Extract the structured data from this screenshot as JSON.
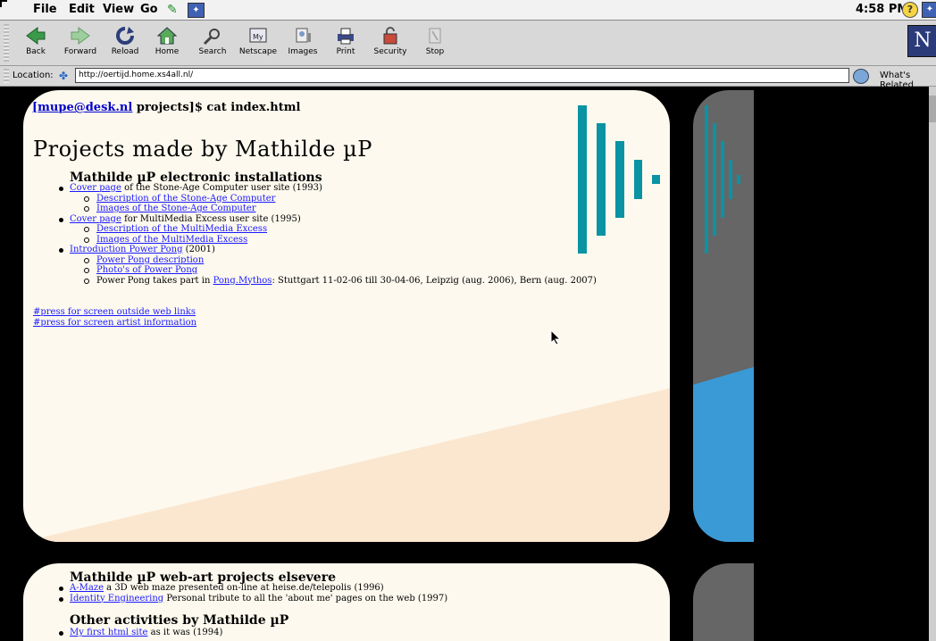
{
  "menubar": {
    "items": [
      "File",
      "Edit",
      "View",
      "Go"
    ],
    "clock": "4:58 PM",
    "help_glyph": "?",
    "app_glyph": "N"
  },
  "toolbar": {
    "buttons": [
      {
        "label": "Back",
        "icon": "back-arrow-icon"
      },
      {
        "label": "Forward",
        "icon": "forward-arrow-icon"
      },
      {
        "label": "Reload",
        "icon": "reload-icon"
      },
      {
        "label": "Home",
        "icon": "home-icon"
      },
      {
        "label": "Search",
        "icon": "search-icon"
      },
      {
        "label": "Netscape",
        "icon": "netscape-icon"
      },
      {
        "label": "Images",
        "icon": "images-icon"
      },
      {
        "label": "Print",
        "icon": "print-icon"
      },
      {
        "label": "Security",
        "icon": "security-lock-icon"
      },
      {
        "label": "Stop",
        "icon": "stop-icon"
      }
    ],
    "logo": "N"
  },
  "location": {
    "label": "Location:",
    "url": "http://oertijd.home.xs4all.nl/",
    "related": "What's Related"
  },
  "page": {
    "prompt_user": "[mupe@desk.nl",
    "prompt_rest": " projects]$ cat index.html",
    "title": "Projects made by Mathilde µP",
    "section1": {
      "heading": "Mathilde µP electronic installations",
      "items": [
        {
          "type": "main",
          "link": "Cover page",
          "text": " of the Stone-Age Computer user site (1993)"
        },
        {
          "type": "sub",
          "link": "Description of the Stone-Age Computer ",
          "text": ""
        },
        {
          "type": "sub",
          "link": "Images of the Stone-Age Computer ",
          "text": ""
        },
        {
          "type": "main",
          "link": "Cover page",
          "text": " for MultiMedia Excess user site (1995)"
        },
        {
          "type": "sub",
          "link": "Description of the MultiMedia Excess",
          "text": ""
        },
        {
          "type": "sub",
          "link": "Images of the MultiMedia Excess",
          "text": ""
        },
        {
          "type": "main",
          "link": "Introduction Power Pong",
          "text": " (2001)"
        },
        {
          "type": "sub",
          "link": "Power Pong description",
          "text": ""
        },
        {
          "type": "sub",
          "link": "Photo's of Power Pong",
          "text": ""
        },
        {
          "type": "sub",
          "pre": "Power Pong takes part in ",
          "link": "Pong.Mythos",
          "text": ": Stuttgart 11-02-06 till 30-04-06, Leipzig (aug. 2006), Bern (aug. 2007)"
        }
      ]
    },
    "press_links": [
      "#press for screen outside web links",
      "#press for screen artist information"
    ],
    "section2": {
      "heading": "Mathilde µP web-art projects elsevere",
      "items": [
        {
          "link": "A-Maze",
          "text": " a 3D web maze presented on-line at heise.de/telepolis (1996)"
        },
        {
          "link": "Identity Engineering",
          "text": " Personal tribute to all the 'about me' pages on the web (1997)"
        }
      ]
    },
    "section3": {
      "heading": "Other activities by Mathilde µP",
      "items": [
        {
          "link": "My first html site",
          "text": " as it was (1994)"
        }
      ]
    }
  },
  "colors": {
    "accent_teal": "#0a93a3",
    "panel_bg": "#fdf9ee",
    "peach": "#fbe6cf",
    "side_blue": "#3a9ad6",
    "link": "#1a1aff"
  }
}
